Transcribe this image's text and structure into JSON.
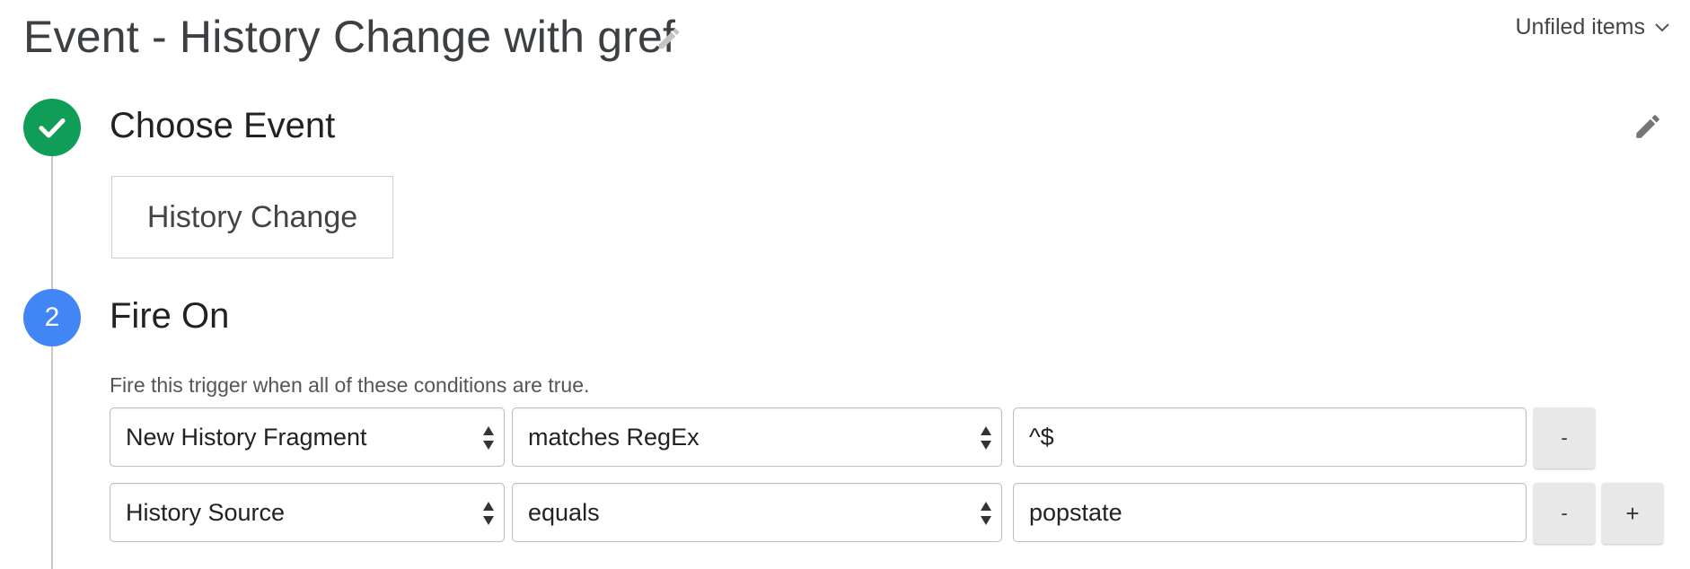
{
  "header": {
    "title": "Event - History Change with gref",
    "title_edit_icon": "pencil-icon",
    "folder_label": "Unfiled items",
    "folder_icon": "chevron-down-icon"
  },
  "steps": [
    {
      "state": "complete",
      "indicator_icon": "checkmark-icon",
      "title": "Choose Event",
      "edit_icon": "pencil-icon",
      "selected_event": "History Change"
    },
    {
      "state": "active",
      "number": "2",
      "title": "Fire On",
      "description": "Fire this trigger when all of these conditions are true.",
      "conditions": [
        {
          "variable": "New History Fragment",
          "operator": "matches RegEx",
          "value": "^$",
          "remove_label": "-"
        },
        {
          "variable": "History Source",
          "operator": "equals",
          "value": "popstate",
          "remove_label": "-",
          "add_label": "+"
        }
      ]
    }
  ],
  "colors": {
    "complete": "#0f9d58",
    "active": "#4285f4",
    "timeline": "#c8c8c8",
    "button_bg": "#e8e8e8"
  }
}
